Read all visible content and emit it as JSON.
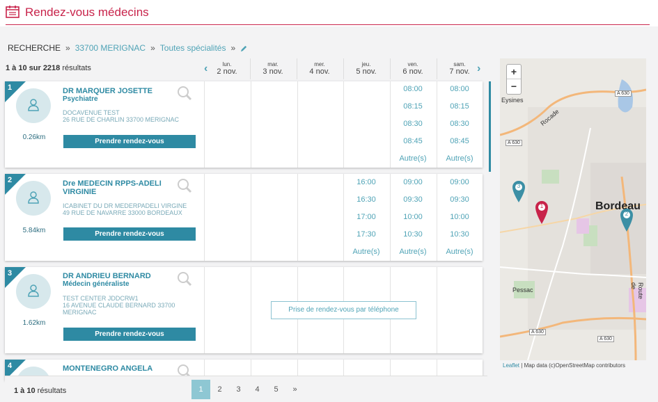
{
  "header": {
    "title": "Rendez-vous médecins",
    "icon": "calendar-icon",
    "color": "#c8234a"
  },
  "breadcrumb": {
    "root": "RECHERCHE",
    "sep": "»",
    "location": "33700 MERIGNAC",
    "specialty": "Toutes spécialités"
  },
  "results": {
    "range": "1 à 10 sur 2218",
    "suffix": "résultats"
  },
  "days": [
    {
      "name": "lun.",
      "date": "2 nov."
    },
    {
      "name": "mar.",
      "date": "3 nov."
    },
    {
      "name": "mer.",
      "date": "4 nov."
    },
    {
      "name": "jeu.",
      "date": "5 nov."
    },
    {
      "name": "ven.",
      "date": "6 nov."
    },
    {
      "name": "sam.",
      "date": "7 nov."
    }
  ],
  "nav": {
    "prev": "‹",
    "next": "›"
  },
  "doctors": [
    {
      "num": "1",
      "name": "DR MARQUER JOSETTE",
      "specialty": "Psychiatre",
      "addr1": "DOCAVENUE TEST",
      "addr2": "26 RUE DE CHARLIN 33700 MERIGNAC",
      "distance": "0.26km",
      "button": "Prendre rendez-vous",
      "slots": {
        "d5": [
          "08:00",
          "08:15",
          "08:30",
          "08:45",
          "Autre(s)"
        ],
        "d6": [
          "08:00",
          "08:15",
          "08:30",
          "08:45",
          "Autre(s)"
        ]
      }
    },
    {
      "num": "2",
      "name": "Dre MEDECIN RPPS-ADELI VIRGINIE",
      "specialty": "",
      "addr1": "ICABINET DU DR MEDERPADELI VIRGINE",
      "addr2": "49 RUE DE NAVARRE 33000 BORDEAUX",
      "distance": "5.84km",
      "button": "Prendre rendez-vous",
      "slots": {
        "d4": [
          "16:00",
          "16:30",
          "17:00",
          "17:30",
          "Autre(s)"
        ],
        "d5": [
          "09:00",
          "09:30",
          "10:00",
          "10:30",
          "Autre(s)"
        ],
        "d6": [
          "09:00",
          "09:30",
          "10:00",
          "10:30",
          "Autre(s)"
        ]
      }
    },
    {
      "num": "3",
      "name": "DR ANDRIEU BERNARD",
      "specialty": "Médecin généraliste",
      "addr1": "TEST CENTER JDDCRW1",
      "addr2": "16 AVENUE CLAUDE BERNARD 33700 MERIGNAC",
      "distance": "1.62km",
      "button": "Prendre rendez-vous",
      "phone": "Prise de rendez-vous par téléphone"
    },
    {
      "num": "4",
      "name": "MONTENEGRO ANGELA"
    }
  ],
  "bottom": {
    "range": "1 à 10",
    "suffix": "résultats",
    "pages": [
      "1",
      "2",
      "3",
      "4",
      "5",
      "»"
    ]
  },
  "map": {
    "zoom_in": "+",
    "zoom_out": "−",
    "labels": {
      "eysines": "Eysines",
      "bordeaux": "Bordeau",
      "pessac": "Pessac",
      "rocade": "Rocade",
      "route": "Route de"
    },
    "roads": {
      "a630": "A 630"
    },
    "markers": [
      "1",
      "2",
      "3"
    ],
    "attrib_link": "Leaflet",
    "attrib_text": "| Map data (c)OpenStreetMap contributors"
  }
}
